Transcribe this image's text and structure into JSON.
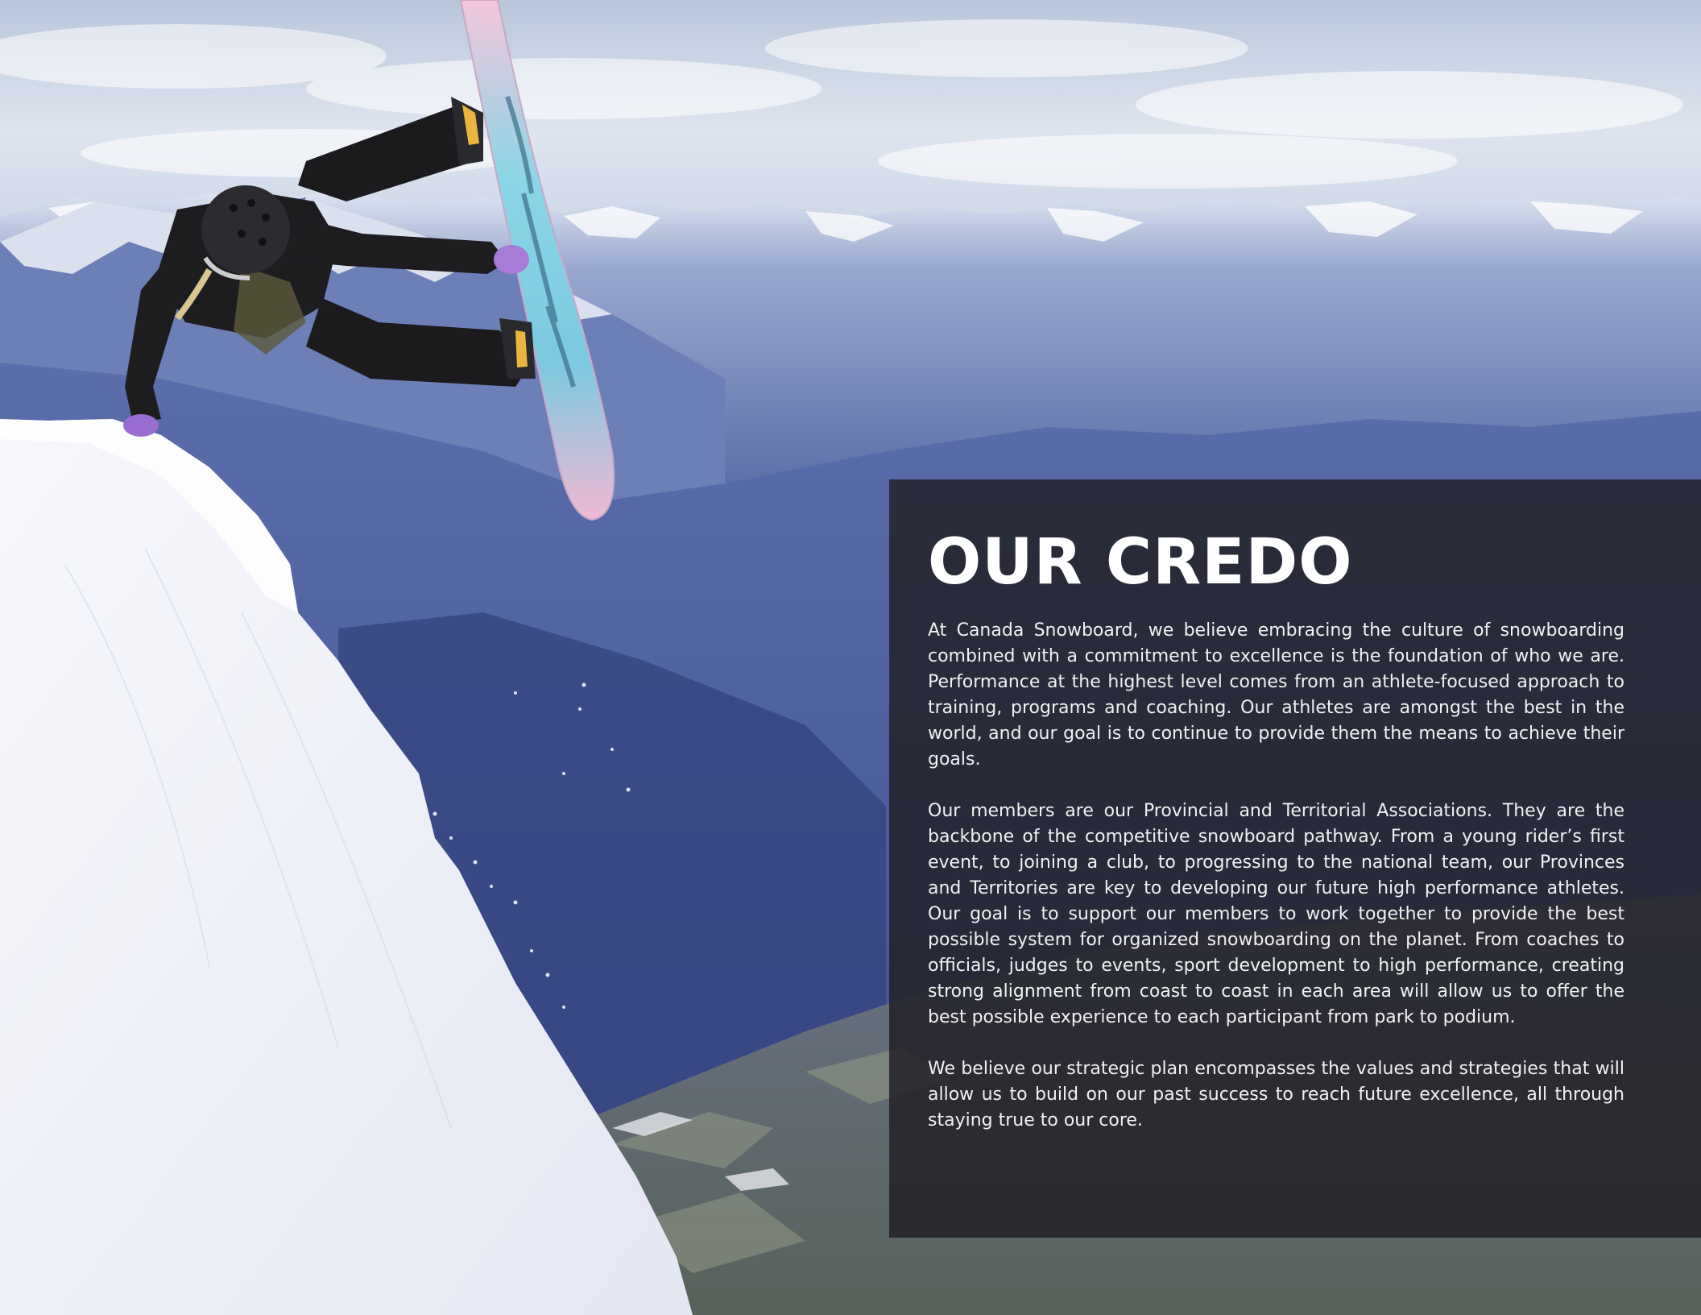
{
  "credo": {
    "title": "OUR CREDO",
    "paragraphs": [
      "At Canada Snowboard, we believe embracing the culture of snowboarding combined with a commitment to excellence is the foundation of who we are. Performance at the highest level comes from an athlete-focused approach to training, programs and coaching. Our athletes are amongst the best in the world, and our goal is to continue to provide them the means to achieve their goals.",
      "Our members are our Provincial and Territorial Associations. They are the backbone of the competitive snowboard pathway. From a young rider’s first event, to joining a club, to progressing to the national team, our Provinces and Territories are key to developing our future high performance athletes. Our goal is to support our members to work together to provide the best possible system for organized snowboarding on the planet. From coaches to officials, judges to events, sport development to high performance, creating strong alignment from coast to coast in each area will allow us to offer the best possible experience to each participant from park to podium.",
      "We believe our strategic plan encompasses the values and strategies that will allow us to build on our past success to reach future excellence, all through staying true to our core."
    ]
  },
  "colors": {
    "panel_background": "#222228",
    "title_text": "#ffffff",
    "body_text": "#f1f1f3",
    "sky": "#c9d3e3",
    "mountains": "#4c5f9a",
    "snow": "#f2f3f8"
  }
}
